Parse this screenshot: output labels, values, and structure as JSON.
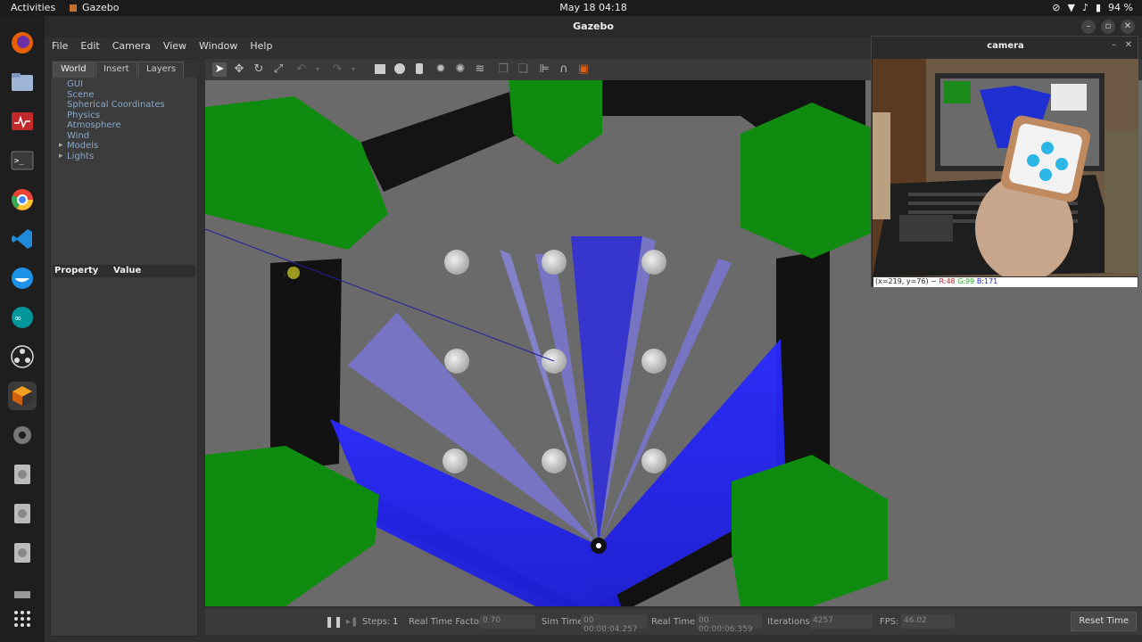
{
  "topbar": {
    "activities": "Activities",
    "app_name": "Gazebo",
    "clock": "May 18  04:18",
    "battery": "94 %"
  },
  "window": {
    "title": "Gazebo",
    "menu": [
      "File",
      "Edit",
      "Camera",
      "View",
      "Window",
      "Help"
    ]
  },
  "left_panel": {
    "tabs": [
      "World",
      "Insert",
      "Layers"
    ],
    "active_tab": "World",
    "tree": [
      "GUI",
      "Scene",
      "Spherical Coordinates",
      "Physics",
      "Atmosphere",
      "Wind",
      "Models",
      "Lights"
    ],
    "expandable": [
      "Models",
      "Lights"
    ],
    "property_header": "Property",
    "value_header": "Value"
  },
  "bottom_bar": {
    "steps_label": "Steps:",
    "steps_value": "1",
    "rtf_label": "Real Time Factor:",
    "rtf_value": "0.70",
    "sim_time_label": "Sim Time:",
    "sim_time_value": "00 00:00:04.257",
    "real_time_label": "Real Time:",
    "real_time_value": "00 00:00:06.359",
    "iterations_label": "Iterations:",
    "iterations_value": "4257",
    "fps_label": "FPS:",
    "fps_value": "46.02",
    "reset_label": "Reset Time"
  },
  "camera_window": {
    "title": "camera",
    "status_prefix": "(x=219, y=76) ~",
    "r": "R:48",
    "g": "G:99",
    "b": "B:171"
  },
  "colors": {
    "obstacle_green": "#0f8c0f",
    "wall_black": "#151515",
    "laser_blue": "#2020e0",
    "cylinder_grey": "#d8d8d8"
  }
}
